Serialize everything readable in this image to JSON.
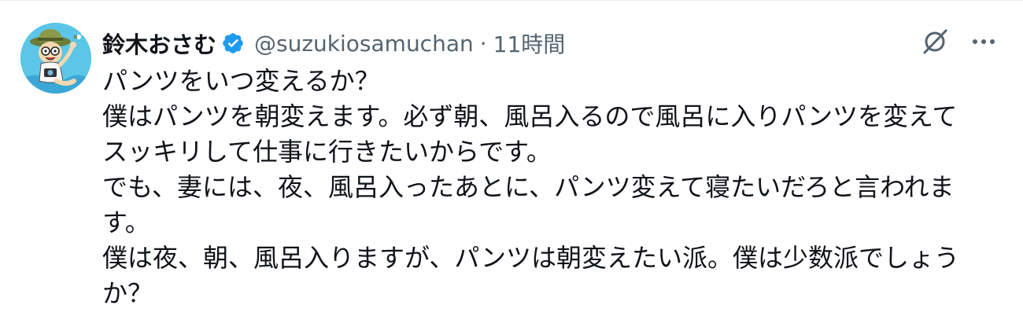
{
  "tweet": {
    "author": {
      "display_name": "鈴木おさむ",
      "handle": "@suzukiosamuchan",
      "verified": true,
      "avatar_icon": "cartoon-avatar-icon"
    },
    "separator": "·",
    "timestamp": "11時間",
    "actions": {
      "grok_icon": "grok-icon",
      "more_icon": "more-options-icon"
    },
    "text_lines": [
      "パンツをいつ変えるか？",
      "僕はパンツを朝変えます。必ず朝、風呂入るので風呂に入りパンツを変えて",
      "スッキリして仕事に行きたいからです。",
      "でも、妻には、夜、風呂入ったあとに、パンツ変えて寝たいだろと言われま",
      "す。",
      "僕は夜、朝、風呂入りますが、パンツは朝変えたい派。僕は少数派でしょう",
      "か？"
    ],
    "colors": {
      "verified": "#1d9bf0",
      "secondary_text": "#536471",
      "primary_text": "#0f1419",
      "avatar_bg": "#5bc6e8"
    }
  }
}
